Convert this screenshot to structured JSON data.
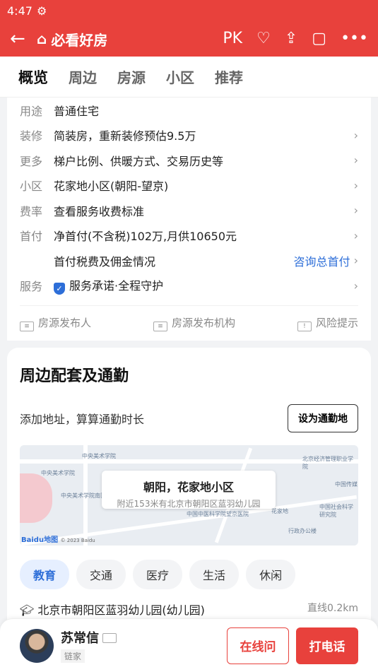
{
  "status": {
    "time": "4:47"
  },
  "header": {
    "brand": "必看好房",
    "pk_label": "PK"
  },
  "tabs": [
    {
      "label": "概览"
    },
    {
      "label": "周边"
    },
    {
      "label": "房源"
    },
    {
      "label": "小区"
    },
    {
      "label": "推荐"
    }
  ],
  "details": {
    "rows": [
      {
        "label": "用途",
        "value": "普通住宅"
      },
      {
        "label": "装修",
        "value": "简装房，重新装修预估9.5万"
      },
      {
        "label": "更多",
        "value": "梯户比例、供暖方式、交易历史等"
      },
      {
        "label": "小区",
        "value": "花家地小区(朝阳-望京)"
      },
      {
        "label": "费率",
        "value": "查看服务收费标准"
      },
      {
        "label": "首付",
        "value": "净首付(不含税)102万,月供10650元"
      },
      {
        "label": "",
        "value": "首付税费及佣金情况",
        "link": "咨询总首付"
      },
      {
        "label": "服务",
        "value": "服务承诺·全程守护"
      }
    ],
    "publishers": {
      "publisher": "房源发布人",
      "agency": "房源发布机构",
      "risk": "风险提示"
    }
  },
  "nearby": {
    "title": "周边配套及通勤",
    "commute_text": "添加地址，算算通勤时长",
    "commute_button": "设为通勤地",
    "map": {
      "place": "朝阳，花家地小区",
      "hint": "附近153米有北京市朝阳区蓝羽幼儿园",
      "attribution": "Baidu地图",
      "copyright": "© 2023 Baidu",
      "labels": [
        "中央美术学院",
        "中央美术学院",
        "北京经济管理职业学院",
        "中国传媒",
        "中央美术学院南区",
        "中国中医科学院望京医院",
        "花家地",
        "行政办公楼",
        "中国社会科学研究院"
      ]
    },
    "chips": [
      "教育",
      "交通",
      "医疗",
      "生活",
      "休闲"
    ],
    "poi": {
      "name": "北京市朝阳区蓝羽幼儿园(幼儿园)",
      "distance": "直线0.2km"
    }
  },
  "agent": {
    "name": "苏常信",
    "company": "链家",
    "online_button": "在线问",
    "call_button": "打电话"
  },
  "colors": {
    "brand": "#e8413c",
    "link": "#2d6ed8"
  }
}
